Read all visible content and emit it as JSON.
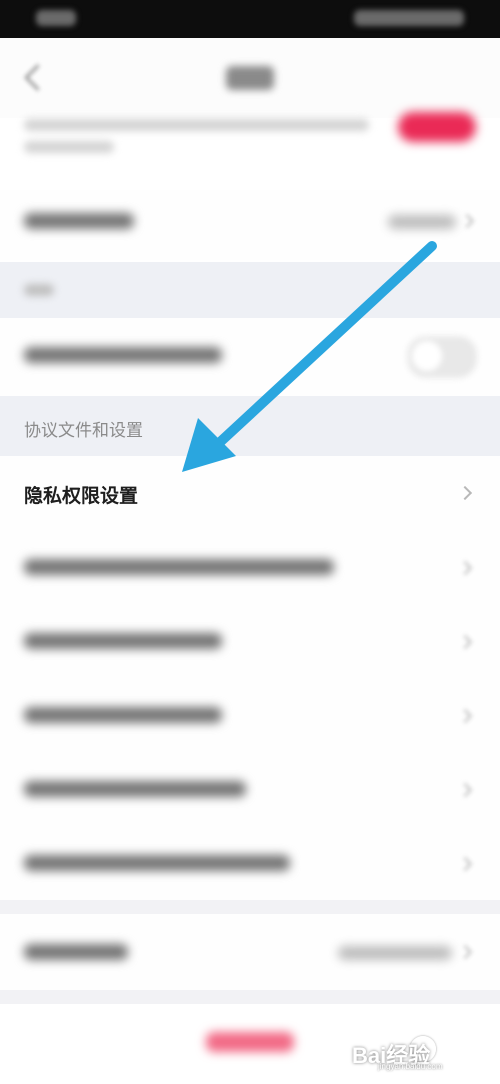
{
  "sections": {
    "agreements_label": "协议文件和设置"
  },
  "privacy_row": {
    "label": "隐私权限设置"
  },
  "colors": {
    "accent": "#ea2a56",
    "arrow": "#2aa6df",
    "section_bg": "#eef0f5"
  },
  "watermark": {
    "text": "Bai经验",
    "url": "jingyan.baidu.com"
  },
  "icons": [
    "back-arrow-icon",
    "chevron-right-icon",
    "pointer-arrow-icon",
    "paw-icon"
  ]
}
